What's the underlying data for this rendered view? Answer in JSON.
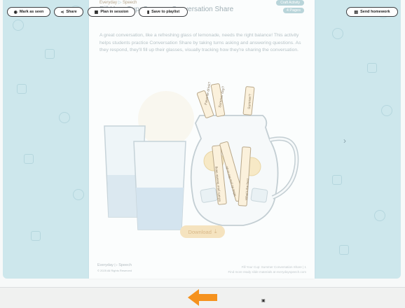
{
  "document": {
    "brand": "Everyday",
    "brand_suffix": "Speech",
    "title": "Fill Your Cup: Summer Conversation Share",
    "badge_type": "Craft Activity",
    "badge_pages": "4 Pages",
    "description": "A great conversation, like a refreshing glass of lemonade, needs the right balance! This activity helps students practice Conversation Share by taking turns asking and answering questions. As they respond, they'll fill up their glasses, visually tracking how they're sharing the conversation.",
    "download_label": "Download",
    "footer_brand": "Everyday",
    "footer_brand_suffix": "Speech",
    "footer_copyright": "© 2025 All Rights Reserved",
    "footer_title": "Fill Your Cup: Summer Conversation Share",
    "footer_page": "1",
    "footer_note": "Find more ready slide materials at everydayspeech.com",
    "straw_texts": [
      "Favorite drink?",
      "Summer day?",
      "Summer?",
      "What's your favorite thing",
      "What do you like to do",
      "What's the best"
    ]
  },
  "navigation": {
    "next_icon": "chevron-right-icon"
  },
  "toolbar": {
    "mark_seen": "Mark as seen",
    "share": "Share",
    "plan_session": "Plan in session",
    "save_playlist": "Save to playlist",
    "send_homework": "Send homework"
  },
  "colors": {
    "annotation_arrow": "#f5921e",
    "viewer_bg": "#cde7ec",
    "button_border": "#3d3f42"
  }
}
